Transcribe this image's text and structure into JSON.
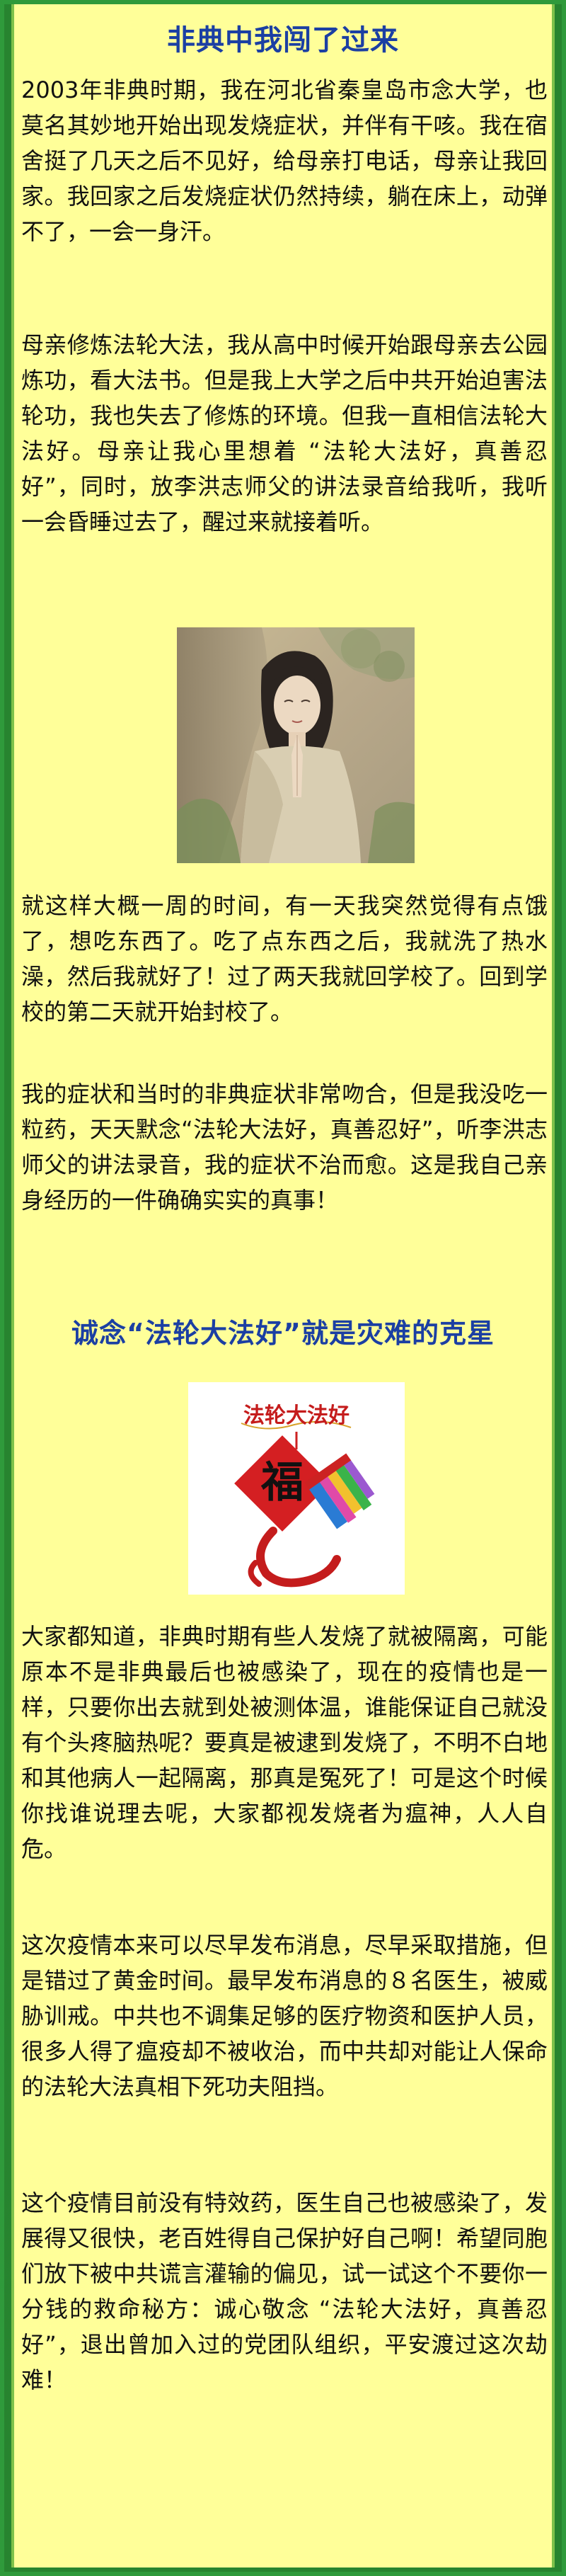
{
  "section1": {
    "title": "非典中我闯了过来",
    "paragraphs": [
      "2003年非典时期，我在河北省秦皇岛市念大学，也莫名其妙地开始出现发烧症状，并伴有干咳。我在宿舍挺了几天之后不见好，给母亲打电话，母亲让我回家。我回家之后发烧症状仍然持续，躺在床上，动弹不了，一会一身汗。",
      "母亲修炼法轮大法，我从高中时候开始跟母亲去公园炼功，看大法书。但是我上大学之后中共开始迫害法轮功，我也失去了修炼的环境。但我一直相信法轮大法好。母亲让我心里想着 “法轮大法好，真善忍好”，同时，放李洪志师父的讲法录音给我听，我听一会昏睡过去了，醒过来就接着听。",
      "就这样大概一周的时间，有一天我突然觉得有点饿了，想吃东西了。吃了点东西之后，我就洗了热水澡，然后我就好了！过了两天我就回学校了。回到学校的第二天就开始封校了。",
      "我的症状和当时的非典症状非常吻合，但是我没吃一粒药，天天默念“法轮大法好，真善忍好”，听李洪志师父的讲法录音，我的症状不治而愈。这是我自己亲身经历的一件确确实实的真事！"
    ]
  },
  "section2": {
    "title": "诚念“法轮大法好”就是灾难的克星",
    "image_text": "法轮大法好",
    "fu_char": "福",
    "paragraphs": [
      "大家都知道，非典时期有些人发烧了就被隔离，可能原本不是非典最后也被感染了，现在的疫情也是一样，只要你出去就到处被测体温，谁能保证自己就没有个头疼脑热呢？要真是被逮到发烧了，不明不白地和其他病人一起隔离，那真是冤死了！可是这个时候你找谁说理去呢，大家都视发烧者为瘟神，人人自危。",
      "这次疫情本来可以尽早发布消息，尽早采取措施，但是错过了黄金时间。最早发布消息的８名医生，被威胁训戒。中共也不调集足够的医疗物资和医护人员，很多人得了瘟疫却不被收治，而中共却对能让人保命的法轮大法真相下死功夫阻挡。",
      "这个疫情目前没有特效药，医生自己也被感染了，发展得又很快，老百姓得自己保护好自己啊！希望同胞们放下被中共谎言灌输的偏见，试一试这个不要你一分钱的救命秘方：诚心敬念 “法轮大法好，真善忍好”，退出曾加入过的党团队组织，平安渡过这次劫难！"
    ]
  },
  "colors": {
    "background_green": "#2f9a3b",
    "panel_yellow": "#ffff99",
    "heading_blue": "#1b3fa3",
    "text": "#111111"
  }
}
